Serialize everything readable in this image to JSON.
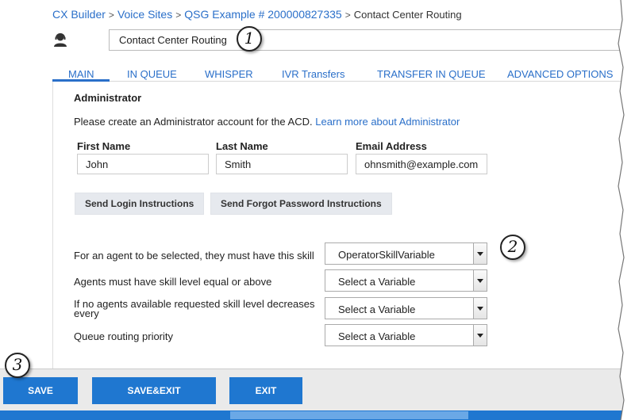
{
  "breadcrumb": {
    "items": [
      "CX Builder",
      "Voice Sites",
      "QSG Example # 200000827335"
    ],
    "separator": ">",
    "current": "Contact Center Routing"
  },
  "header": {
    "site_icon": "agent-headset-icon",
    "name_value": "Contact Center Routing"
  },
  "callouts": [
    "1",
    "2",
    "3"
  ],
  "tabs": [
    {
      "label": "MAIN",
      "active": true
    },
    {
      "label": "IN QUEUE"
    },
    {
      "label": "WHISPER"
    },
    {
      "label": "IVR Transfers"
    },
    {
      "label": "TRANSFER IN QUEUE"
    },
    {
      "label": "ADVANCED OPTIONS"
    }
  ],
  "admin": {
    "title": "Administrator",
    "intro": "Please create an Administrator account for the ACD.",
    "learn_more": "Learn more about Administrator",
    "first_name_label": "First Name",
    "first_name_value": "John",
    "last_name_label": "Last Name",
    "last_name_value": "Smith",
    "email_label": "Email Address",
    "email_value": "ohnsmith@example.com",
    "send_login_label": "Send Login Instructions",
    "send_forgot_label": "Send Forgot Password Instructions"
  },
  "skills": [
    {
      "label": "For an agent to be selected, they must have this skill",
      "value": "OperatorSkillVariable"
    },
    {
      "label": "Agents must have skill level equal or above",
      "value": "Select a Variable"
    },
    {
      "label": "If no agents available requested skill level decreases every",
      "value": "Select a Variable"
    },
    {
      "label": "Queue routing priority",
      "value": "Select a Variable"
    }
  ],
  "footer": {
    "save_label": "SAVE",
    "save_exit_label": "SAVE&EXIT",
    "exit_label": "EXIT"
  },
  "colors": {
    "accent": "#2a6fc9",
    "button_blue": "#1f77d0"
  }
}
